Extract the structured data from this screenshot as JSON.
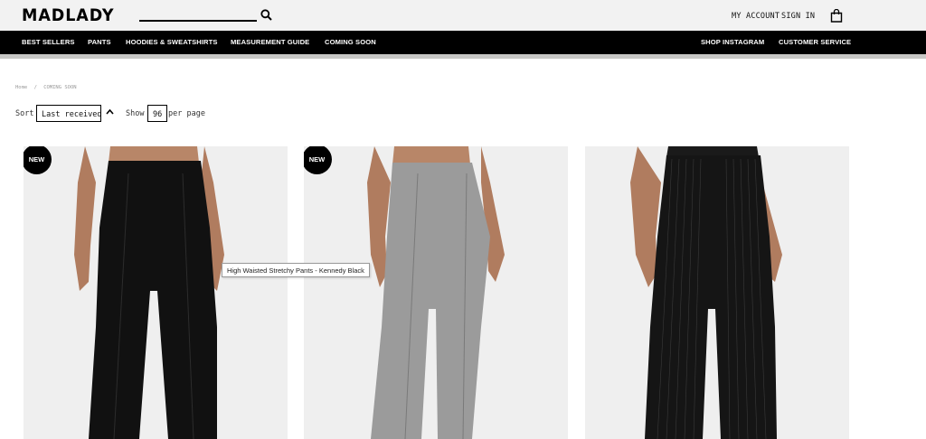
{
  "header": {
    "logo": "MADLADY",
    "search_placeholder": "",
    "account_label": "MY ACCOUNT",
    "signin_label": "SIGN IN"
  },
  "nav": {
    "left": [
      "BEST SELLERS",
      "PANTS",
      "HOODIES & SWEATSHIRTS",
      "MEASUREMENT GUIDE",
      "COMING SOON"
    ],
    "right": [
      "SHOP INSTAGRAM",
      "CUSTOMER SERVICE"
    ]
  },
  "breadcrumb": {
    "home": "Home",
    "separator": "/",
    "current": "COMING SOON"
  },
  "controls": {
    "sort_label": "Sort",
    "sort_value": "Last received",
    "show_label": "Show",
    "show_value": "96",
    "per_page_label": "per page"
  },
  "products": [
    {
      "badge": "NEW",
      "color": "#111111",
      "style": "black stretchy"
    },
    {
      "badge": "NEW",
      "color": "#9a9a9a",
      "style": "grey stretchy"
    },
    {
      "badge": "",
      "color": "#1a1a1a",
      "style": "black pinstripe"
    }
  ],
  "tooltip": "High Waisted Stretchy Pants - Kennedy Black",
  "colors": {
    "header_bg": "#f2f2f2",
    "nav_bg": "#000000",
    "nav_text": "#ffffff",
    "card_bg": "#eeeeee"
  }
}
